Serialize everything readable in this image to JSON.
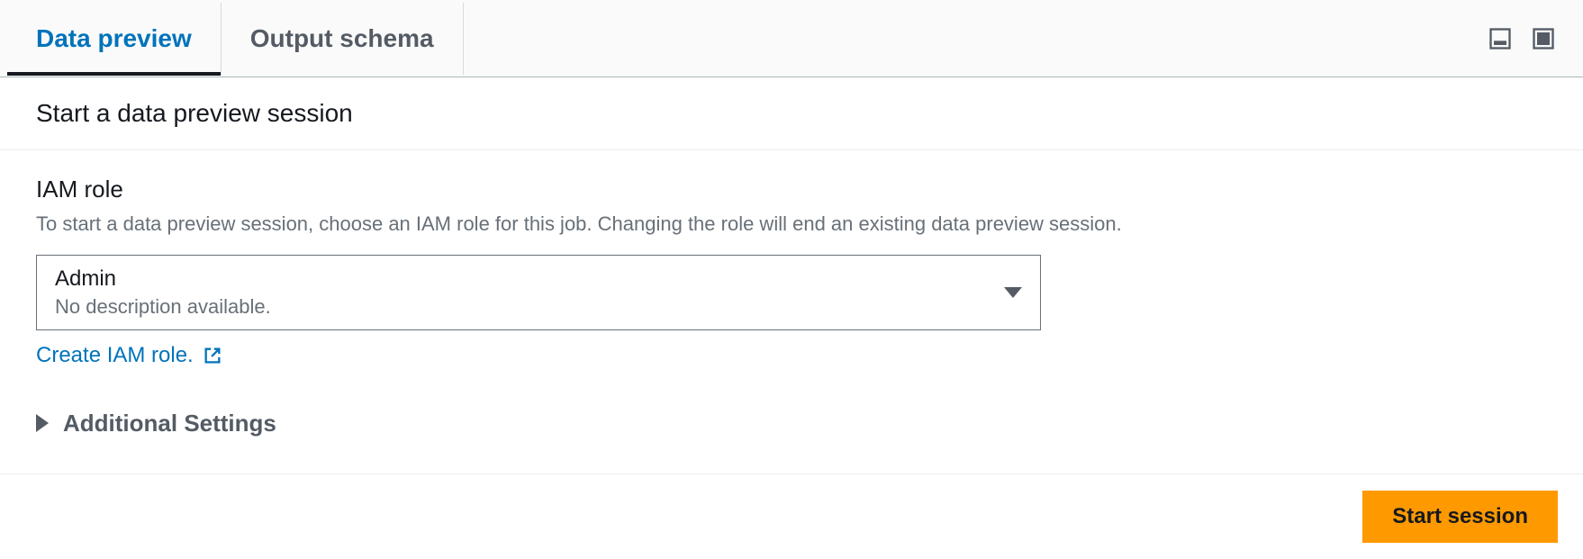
{
  "tabs": {
    "data_preview": "Data preview",
    "output_schema": "Output schema"
  },
  "section": {
    "title": "Start a data preview session"
  },
  "iam_role": {
    "label": "IAM role",
    "description": "To start a data preview session, choose an IAM role for this job. Changing the role will end an existing data preview session.",
    "selected_value": "Admin",
    "selected_subtext": "No description available.",
    "create_link": "Create IAM role."
  },
  "additional_settings": {
    "label": "Additional Settings"
  },
  "actions": {
    "start_session": "Start session"
  }
}
